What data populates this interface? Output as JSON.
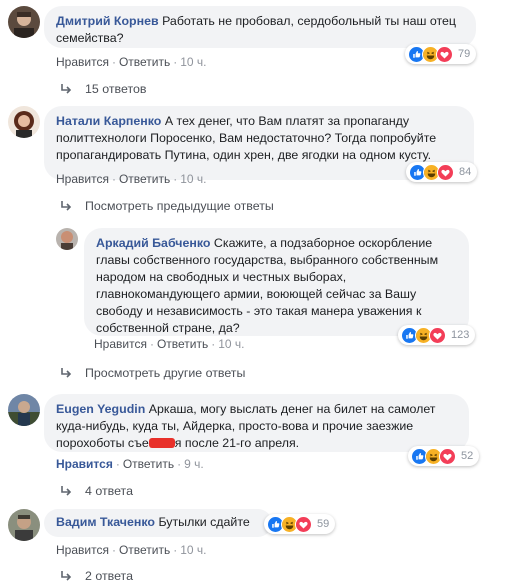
{
  "comments": [
    {
      "author": "Дмитрий Корнев",
      "text": "Работать не пробовал, сердобольный ты наш отец семейства?",
      "reactions_count": "79",
      "like": "Нравится",
      "reply": "Ответить",
      "time": "10 ч.",
      "replies": "15 ответов"
    },
    {
      "author": "Натали Карпенко",
      "text": "А тех денег, что Вам платят за пропаганду политтехнологи Поросенко, Вам недостаточно? Тогда попробуйте пропагандировать Путина, один хрен, две ягодки на одном кусту.",
      "reactions_count": "84",
      "like": "Нравится",
      "reply": "Ответить",
      "time": "10 ч.",
      "prev_replies": "Посмотреть предыдущие ответы",
      "nested": {
        "author": "Аркадий Бабченко",
        "text": "Скажите, а подзаборное оскорбление главы собственного государства, выбранного собственным народом на свободных и честных выборах, главнокомандующего армии, воюющей сейчас за Вашу свободу и независимость - это такая манера уважения к собственной стране, да?",
        "reactions_count": "123",
        "like": "Нравится",
        "reply": "Ответить",
        "time": "10 ч."
      },
      "other_replies": "Просмотреть другие ответы"
    },
    {
      "author": "Eugen Yegudin",
      "text_before": "Аркаша, могу выслать денег на билет на самолет куда-нибудь, куда ты, Айдерка, просто-вова и прочие заезжие порохоботы съе",
      "text_after": "я после 21-го апреля.",
      "reactions_count": "52",
      "like": "Нравится",
      "reply": "Ответить",
      "time": "9 ч.",
      "replies": "4 ответа"
    },
    {
      "author": "Вадим Ткаченко",
      "text": "Бутылки сдайте",
      "reactions_count": "59",
      "like": "Нравится",
      "reply": "Ответить",
      "time": "10 ч.",
      "replies": "2 ответа"
    }
  ],
  "icons": {
    "like": "like-reaction-icon",
    "haha": "haha-reaction-icon",
    "love": "love-reaction-icon",
    "reply_arrow": "reply-arrow-icon"
  },
  "colors": {
    "author": "#385898",
    "bubble": "#f2f3f5",
    "like": "#1877f2",
    "love": "#f33e58",
    "haha": "#f7b125"
  }
}
